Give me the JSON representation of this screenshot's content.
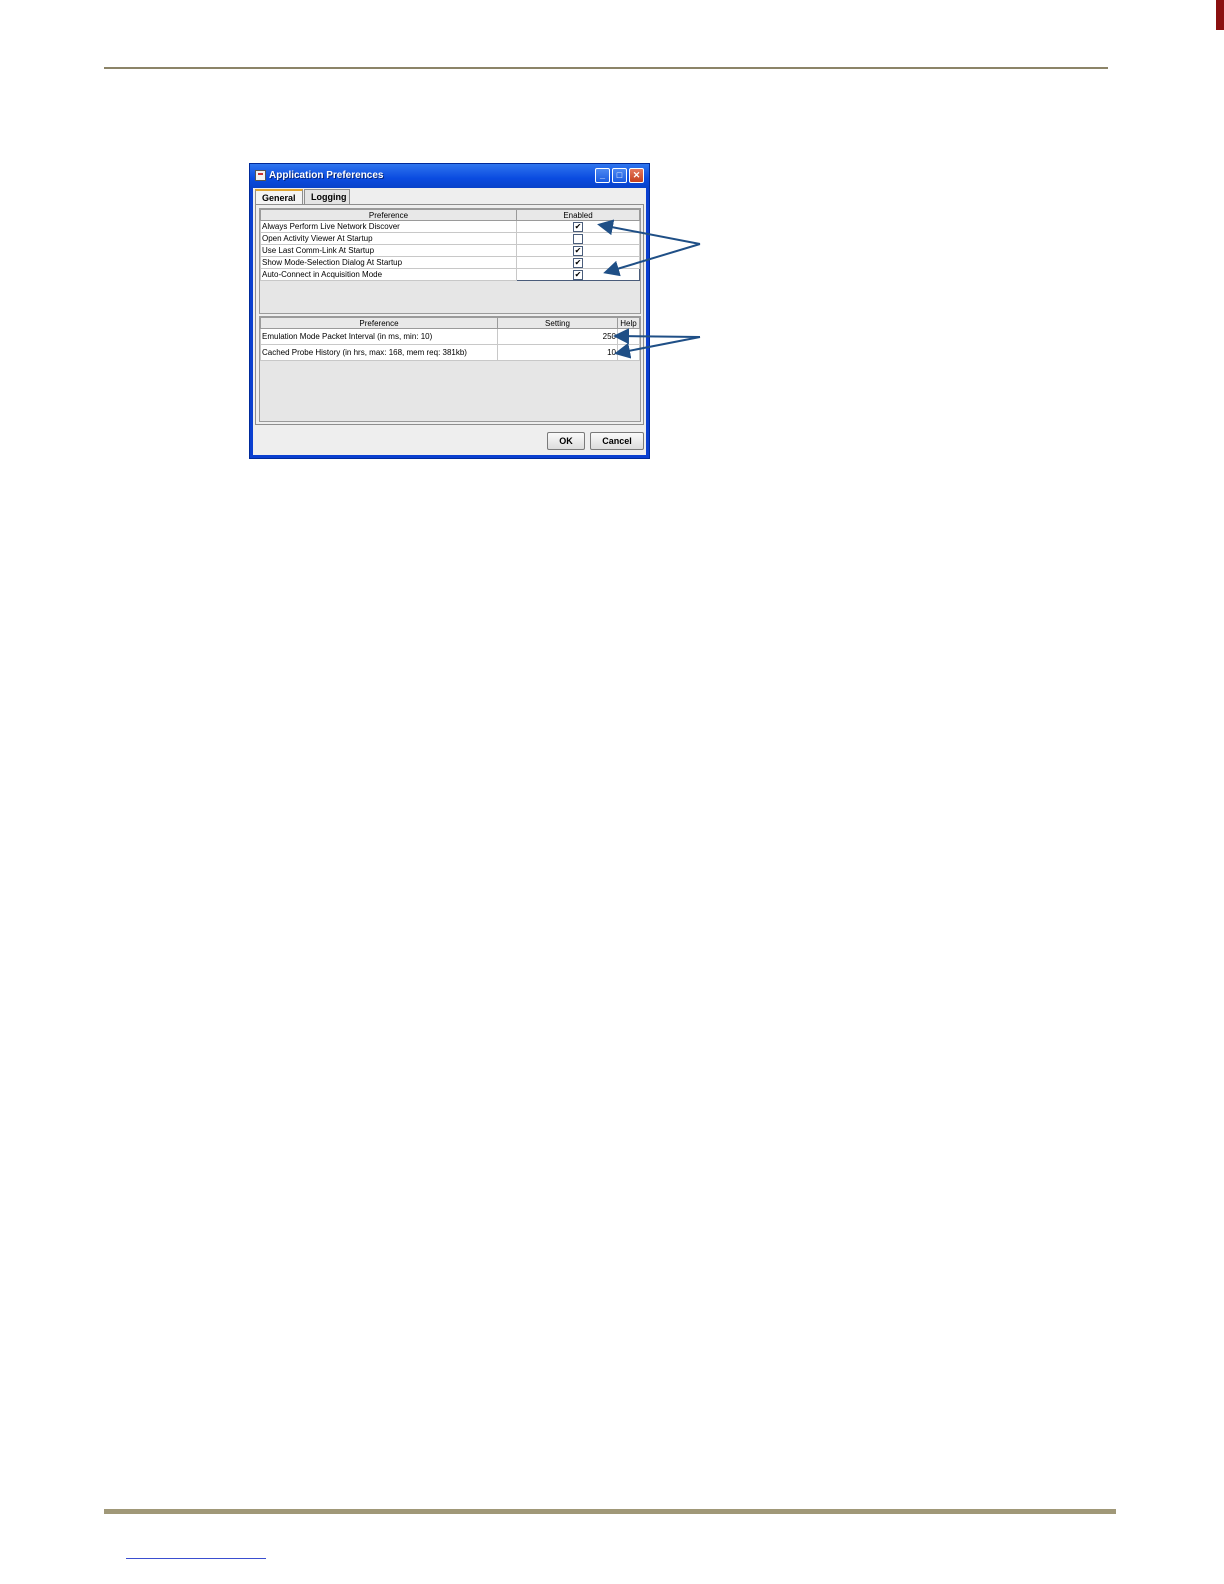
{
  "window": {
    "title": "Application Preferences",
    "controls": {
      "minimize": "_",
      "maximize": "□",
      "close": "✕"
    }
  },
  "tabs": [
    {
      "label": "General",
      "selected": true
    },
    {
      "label": "Logging",
      "selected": false
    }
  ],
  "boolean_table": {
    "headers": [
      "Preference",
      "Enabled"
    ],
    "rows": [
      {
        "label": "Always Perform Live Network Discover",
        "checked": true
      },
      {
        "label": "Open Activity Viewer At Startup",
        "checked": false
      },
      {
        "label": "Use Last Comm-Link At Startup",
        "checked": true
      },
      {
        "label": "Show Mode-Selection Dialog At Startup",
        "checked": true
      },
      {
        "label": "Auto-Connect in Acquisition Mode",
        "checked": true
      }
    ]
  },
  "setting_table": {
    "headers": [
      "Preference",
      "Setting",
      "Help"
    ],
    "rows": [
      {
        "label": "Emulation Mode Packet Interval (in ms, min: 10)",
        "value": "250"
      },
      {
        "label": "Cached Probe History (in hrs, max: 168, mem req: 381kb)",
        "value": "10"
      }
    ]
  },
  "buttons": {
    "ok": "OK",
    "cancel": "Cancel"
  },
  "callout_color": "#1f4f86"
}
